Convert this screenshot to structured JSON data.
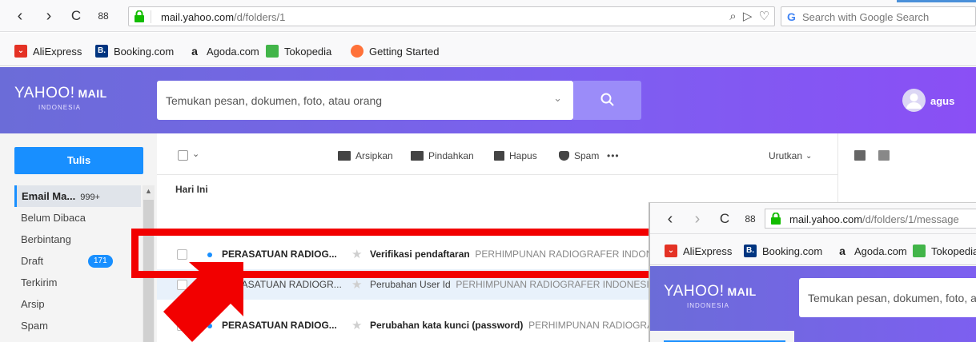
{
  "browser": {
    "url_host": "mail.yahoo.com",
    "url_path": "/d/folders/1",
    "search_placeholder": "Search with Google Search",
    "nav": {
      "back": "‹",
      "forward": "›",
      "reload": "C",
      "apps": "88"
    },
    "bookmarks": [
      {
        "label": "AliExpress",
        "icon": "aliexpress-icon",
        "color": "#e43225",
        "glyph": ""
      },
      {
        "label": "Booking.com",
        "icon": "booking-icon",
        "color": "#003580",
        "glyph": "B."
      },
      {
        "label": "Agoda.com",
        "icon": "agoda-icon",
        "color": "#ffffff",
        "glyph": "a"
      },
      {
        "label": "Tokopedia",
        "icon": "tokopedia-icon",
        "color": "#42b549",
        "glyph": ""
      },
      {
        "label": "Getting Started",
        "icon": "firefox-icon",
        "color": "#ff7139",
        "glyph": ""
      }
    ]
  },
  "yahoo": {
    "logo": "YAHOO!",
    "logo_mail": "MAIL",
    "logo_sub": "INDONESIA",
    "search_placeholder": "Temukan pesan, dokumen, foto, atau orang",
    "user_name": "agus"
  },
  "sidebar": {
    "compose": "Tulis",
    "folders": [
      {
        "label": "Email Ma...",
        "count": "999+",
        "active": true
      },
      {
        "label": "Belum Dibaca"
      },
      {
        "label": "Berbintang"
      },
      {
        "label": "Draft",
        "badge": "171"
      },
      {
        "label": "Terkirim"
      },
      {
        "label": "Arsip"
      },
      {
        "label": "Spam"
      }
    ]
  },
  "toolbar": {
    "archive": "Arsipkan",
    "move": "Pindahkan",
    "delete": "Hapus",
    "spam": "Spam",
    "more": "•••",
    "sort": "Urutkan"
  },
  "list": {
    "group_label": "Hari Ini",
    "messages": [
      {
        "sender": "PERASATUAN RADIOG...",
        "subject": "Verifikasi pendaftaran",
        "preview": "PERHIMPUNAN RADIOGRAFER INDONESIA",
        "unread": true
      },
      {
        "sender": "PERASATUAN RADIOGR...",
        "subject": "Perubahan User Id",
        "preview": "PERHIMPUNAN RADIOGRAFER INDONESIA",
        "unread": false
      },
      {
        "sender": "PERASATUAN RADIOG...",
        "subject": "Perubahan kata kunci (password)",
        "preview": "PERHIMPUNAN RADIOGRAFER INDONESIA",
        "unread": true
      }
    ]
  },
  "inset": {
    "url_host": "mail.yahoo.com",
    "url_path": "/d/folders/1/message",
    "bookmarks": [
      "AliExpress",
      "Booking.com",
      "Agoda.com",
      "Tokopedia"
    ],
    "logo": "YAHOO!",
    "logo_mail": "MAIL",
    "logo_sub": "INDONESIA",
    "search_placeholder": "Temukan pesan, dokumen, foto, a"
  },
  "colors": {
    "accent": "#188fff",
    "header_start": "#6b6cd8",
    "header_end": "#8a4ff5",
    "annotation": "#f20000"
  }
}
